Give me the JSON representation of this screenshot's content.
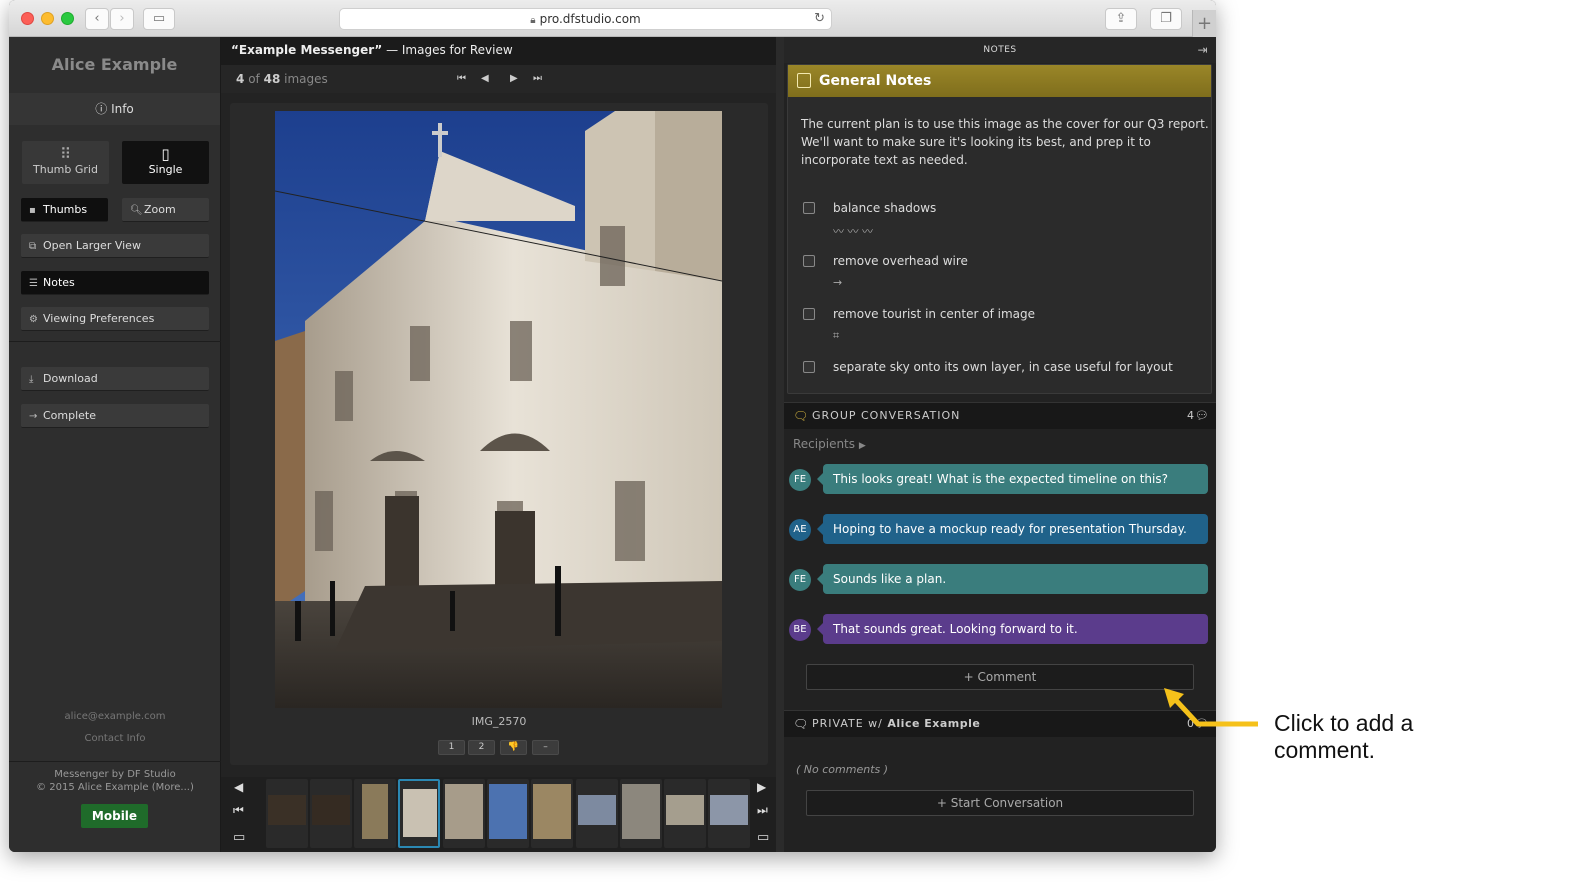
{
  "browser": {
    "url": "pro.dfstudio.com"
  },
  "sidebar": {
    "user_name": "Alice Example",
    "info_label": "Info",
    "view_tiles": [
      {
        "label": "Thumb Grid",
        "icon": "grid-icon",
        "active": false
      },
      {
        "label": "Single",
        "icon": "single-icon",
        "active": true
      }
    ],
    "thumbs_label": "Thumbs",
    "zoom_label": "Zoom",
    "open_larger_label": "Open Larger View",
    "notes_label": "Notes",
    "viewing_prefs_label": "Viewing Preferences",
    "download_label": "Download",
    "complete_label": "Complete",
    "email": "alice@example.com",
    "contact_label": "Contact Info",
    "footer_line1": "Messenger by DF Studio",
    "footer_line2": "© 2015 Alice Example (More...)",
    "mobile_label": "Mobile"
  },
  "center": {
    "title": "“Example Messenger”",
    "title_suffix": " — Images for Review",
    "position_current": "4",
    "position_of": "of",
    "position_total": "48",
    "position_unit": "images",
    "filename": "IMG_2570",
    "rating_buttons": [
      "1",
      "2",
      "👎",
      "–"
    ],
    "thumbnail_count": 11,
    "selected_thumbnail": 4
  },
  "notes": {
    "header": "NOTES",
    "general_title": "General Notes",
    "general_text": "The current plan is to use this image as the cover for our Q3 report. We'll want to make sure it's looking its best, and prep it to incorporate text as needed.",
    "tasks": [
      {
        "label": "balance shadows",
        "tool": "〰 〰 〰"
      },
      {
        "label": "remove overhead wire",
        "tool": "→"
      },
      {
        "label": "remove tourist in center of image",
        "tool": "⌗"
      },
      {
        "label": "separate sky onto its own layer, in case useful for layout",
        "tool": ""
      }
    ],
    "group_title": "GROUP CONVERSATION",
    "group_count": "4",
    "recipients_label": "Recipients",
    "messages": [
      {
        "initials": "FE",
        "text": "This looks great! What is the expected timeline on this?",
        "color": "#3a7d7d"
      },
      {
        "initials": "AE",
        "text": "Hoping to have a mockup ready for presentation Thursday.",
        "color": "#20628a"
      },
      {
        "initials": "FE",
        "text": "Sounds like a plan.",
        "color": "#3a7d7d"
      },
      {
        "initials": "BE",
        "text": "That sounds great. Looking forward to it.",
        "color": "#5b3c8c"
      }
    ],
    "comment_button": "+ Comment",
    "private_prefix": "PRIVATE w/ ",
    "private_name": "Alice Example",
    "private_count": "0",
    "no_comments": "( No comments )",
    "start_conversation": "+ Start Conversation"
  },
  "annotation": {
    "text_line1": "Click to add a",
    "text_line2": "comment.",
    "arrow_color": "#f5c11a"
  }
}
